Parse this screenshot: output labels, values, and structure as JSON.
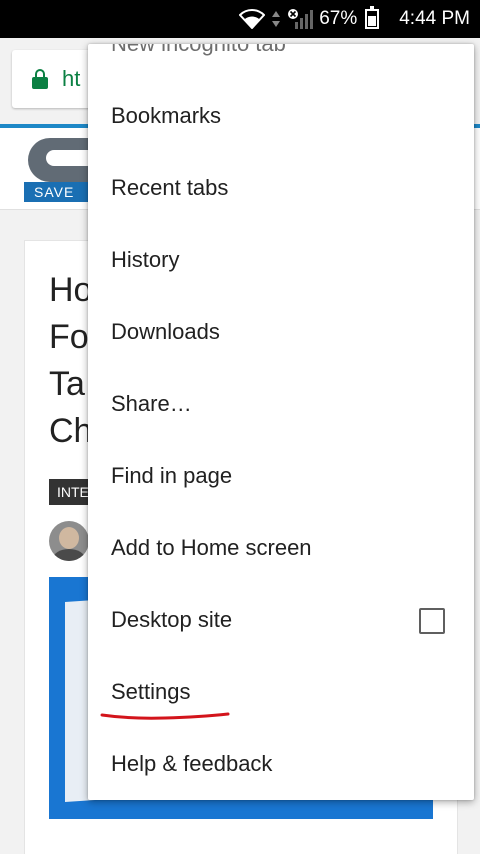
{
  "status_bar": {
    "battery_percent": "67%",
    "time": "4:44 PM",
    "icons": [
      "wifi-icon",
      "data-arrows-icon",
      "no-sim-icon",
      "signal-icon",
      "battery-icon"
    ]
  },
  "toolbar": {
    "url_partial": "ht",
    "lock_color": "#0b8043",
    "progress_line_color": "#1e88c7"
  },
  "page": {
    "logo_banner_text": "SAVE",
    "title_lines": [
      "Ho",
      "Fo",
      "Ta",
      "Ch"
    ],
    "tag_text": "INTE"
  },
  "menu": {
    "items": [
      {
        "label": "New incognito tab"
      },
      {
        "label": "Bookmarks"
      },
      {
        "label": "Recent tabs"
      },
      {
        "label": "History"
      },
      {
        "label": "Downloads"
      },
      {
        "label": "Share…"
      },
      {
        "label": "Find in page"
      },
      {
        "label": "Add to Home screen"
      },
      {
        "label": "Desktop site",
        "checkbox_checked": false
      },
      {
        "label": "Settings"
      },
      {
        "label": "Help & feedback"
      }
    ],
    "annotation_color": "#d3141b"
  }
}
